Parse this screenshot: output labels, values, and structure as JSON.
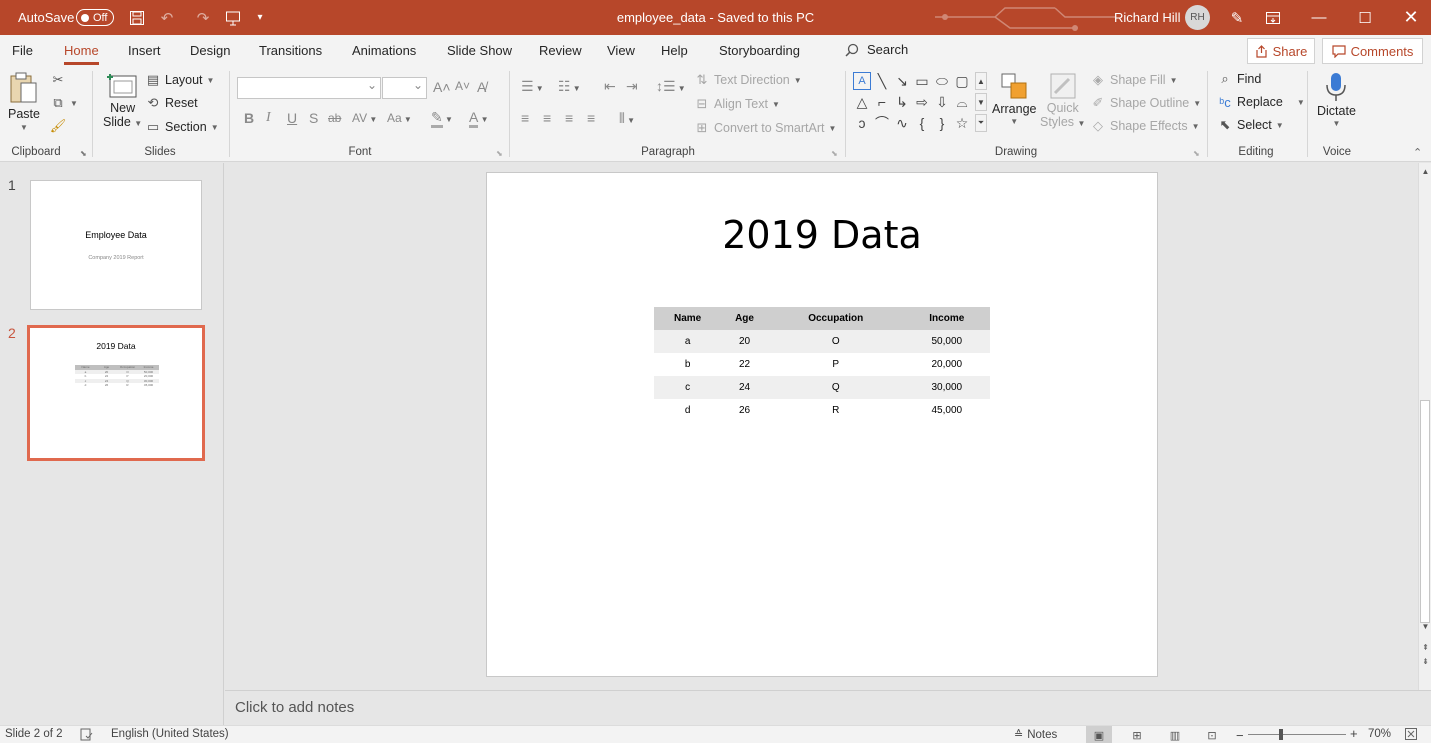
{
  "titlebar": {
    "autosave_label": "AutoSave",
    "autosave_state": "Off",
    "document_title": "employee_data  -  Saved to this PC",
    "user_name": "Richard Hill",
    "user_initials": "RH"
  },
  "tabs": [
    "File",
    "Home",
    "Insert",
    "Design",
    "Transitions",
    "Animations",
    "Slide Show",
    "Review",
    "View",
    "Help",
    "Storyboarding"
  ],
  "search": {
    "label": "Search"
  },
  "actions": {
    "share": "Share",
    "comments": "Comments"
  },
  "ribbon": {
    "clipboard": {
      "paste": "Paste",
      "group": "Clipboard"
    },
    "slides": {
      "new_slide_line1": "New",
      "new_slide_line2": "Slide",
      "layout": "Layout",
      "reset": "Reset",
      "section": "Section",
      "group": "Slides"
    },
    "font": {
      "group": "Font",
      "bold": "B",
      "italic": "I",
      "underline": "U",
      "strike": "S",
      "strikethrough": "ab",
      "spacing": "AV",
      "case": "Aa",
      "grow": "A",
      "shrink": "A"
    },
    "paragraph": {
      "group": "Paragraph",
      "text_direction": "Text Direction",
      "align_text": "Align Text",
      "convert_smartart": "Convert to SmartArt"
    },
    "drawing": {
      "group": "Drawing",
      "arrange": "Arrange",
      "quick_styles_line1": "Quick",
      "quick_styles_line2": "Styles",
      "shape_fill": "Shape Fill",
      "shape_outline": "Shape Outline",
      "shape_effects": "Shape Effects"
    },
    "editing": {
      "group": "Editing",
      "find": "Find",
      "replace": "Replace",
      "select": "Select"
    },
    "voice": {
      "group": "Voice",
      "dictate": "Dictate"
    }
  },
  "thumbnails": [
    {
      "number": "1",
      "title": "Employee Data",
      "subtitle": "Company 2019 Report"
    },
    {
      "number": "2",
      "title": "2019 Data"
    }
  ],
  "slide": {
    "title": "2019 Data",
    "table": {
      "headers": [
        "Name",
        "Age",
        "Occupation",
        "Income"
      ],
      "rows": [
        [
          "a",
          "20",
          "O",
          "50,000"
        ],
        [
          "b",
          "22",
          "P",
          "20,000"
        ],
        [
          "c",
          "24",
          "Q",
          "30,000"
        ],
        [
          "d",
          "26",
          "R",
          "45,000"
        ]
      ]
    }
  },
  "notes": {
    "placeholder": "Click to add notes"
  },
  "statusbar": {
    "slide_info": "Slide 2 of 2",
    "language": "English (United States)",
    "notes": "Notes",
    "zoom": "70%"
  },
  "colors": {
    "accent": "#b7472a",
    "selection": "#e0694e"
  }
}
